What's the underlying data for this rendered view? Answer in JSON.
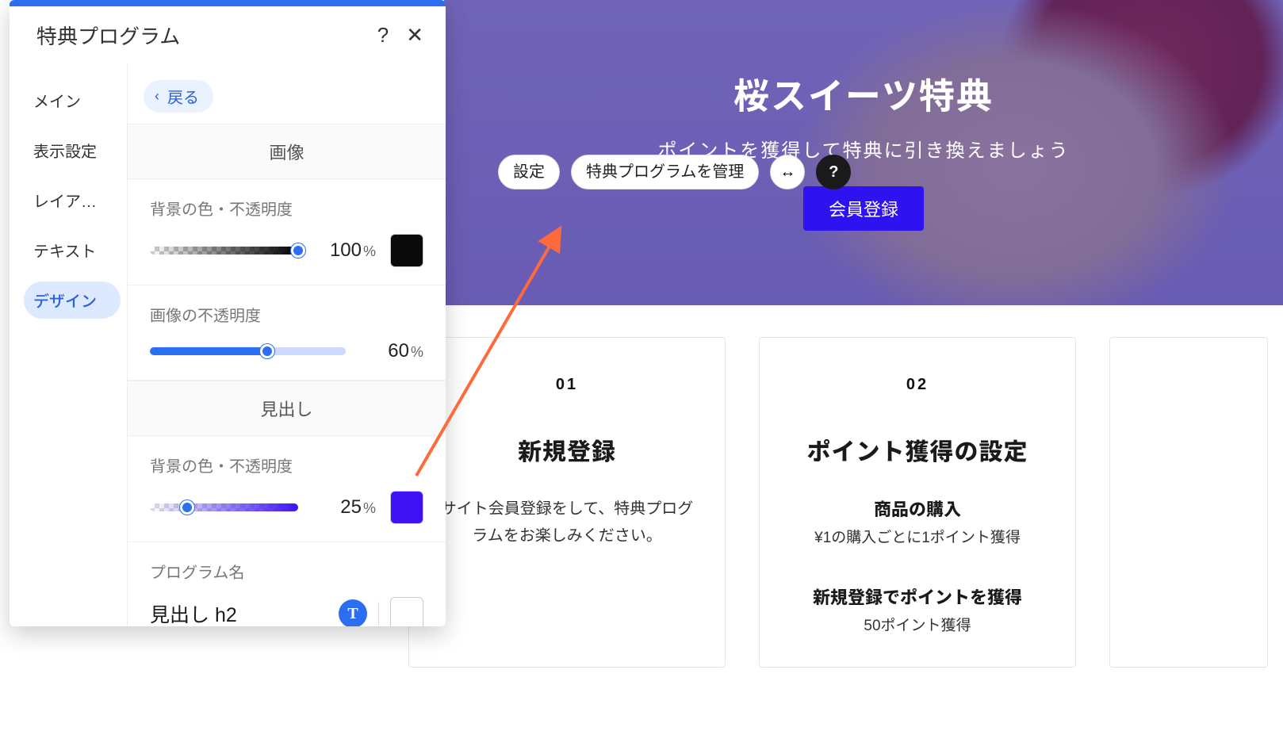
{
  "panel": {
    "title": "特典プログラム",
    "help_icon": "?",
    "close_icon": "✕",
    "tabs": [
      "メイン",
      "表示設定",
      "レイア…",
      "テキスト",
      "デザイン"
    ],
    "active_tab_index": 4,
    "back_label": "戻る",
    "sections": {
      "image": {
        "heading": "画像",
        "bg_label": "背景の色・不透明度",
        "bg_value": 100,
        "bg_swatch": "#0a0a0a",
        "img_label": "画像の不透明度",
        "img_value": 60
      },
      "title": {
        "heading": "見出し",
        "bg_label": "背景の色・不透明度",
        "bg_value": 25,
        "bg_swatch": "#3e12f5",
        "program_name_label": "プログラム名",
        "heading_style": "見出し h2"
      }
    }
  },
  "toolbar": {
    "settings": "設定",
    "manage": "特典プログラムを管理",
    "stretch_icon": "↔",
    "help_icon": "?"
  },
  "hero": {
    "title": "桜スイーツ特典",
    "subtitle": "ポイントを獲得して特典に引き換えましょう",
    "cta": "会員登録"
  },
  "steps": [
    {
      "num": "01",
      "title": "新規登録",
      "lead": "サイト会員登録をして、特典プログラムをお楽しみください。"
    },
    {
      "num": "02",
      "title": "ポイント獲得の設定",
      "items": [
        {
          "title": "商品の購入",
          "sub": "¥1の購入ごとに1ポイント獲得"
        },
        {
          "title": "新規登録でポイントを獲得",
          "sub": "50ポイント獲得"
        }
      ]
    },
    {
      "num": "",
      "title": "",
      "lead": ""
    }
  ]
}
